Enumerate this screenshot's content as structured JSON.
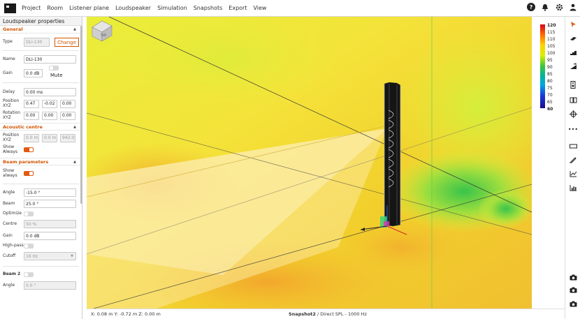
{
  "menu": [
    "Project",
    "Room",
    "Listener plane",
    "Loudspeaker",
    "Simulation",
    "Snapshots",
    "Export",
    "View"
  ],
  "panel": {
    "title": "Loudspeaker properties",
    "general": "General",
    "type_label": "Type",
    "type_value": "DLI-130",
    "change_button": "Change",
    "name_label": "Name",
    "name_value": "DLI-130",
    "gain_label": "Gain",
    "gain_value": "0.0 dB",
    "mute_label": "Mute",
    "delay_label": "Delay",
    "delay_value": "0.00 ms",
    "position_label": "Position XYZ",
    "position": [
      "0.47",
      "-0.02",
      "0.00"
    ],
    "rotation_label": "Rotation XYZ",
    "rotation": [
      "0.00",
      "0.00",
      "0.00"
    ],
    "acoustic_centre": "Acoustic centre",
    "ac_position_label": "Position XYZ",
    "ac_position": [
      "0.0 m",
      "0.0 m",
      "942.0"
    ],
    "show_always_label": "Show Always",
    "beam_parameters": "Beam parameters",
    "show_always2_label": "Show always",
    "angle_label": "Angle",
    "angle_value": "-15.0 °",
    "beam_label": "Beam",
    "beam_value": "25.0 °",
    "optimize_label": "Optimize",
    "centre_label": "Centre",
    "centre_value": "50 %",
    "gain2_label": "Gain",
    "gain2_value": "0.0 dB",
    "highpass_label": "High-pass",
    "cutoff_label": "Cutoff",
    "cutoff_value": "16 Hz",
    "beam2_label": "Beam 2",
    "angle2_label": "Angle",
    "angle2_value": "0.0 °"
  },
  "status": {
    "coords": "X: 0.08 m Y: -0.72 m Z: 0.00 m",
    "snapshot": "Snapshot2",
    "view": " / Direct SPL - 1000 Hz"
  },
  "scale": {
    "ticks": [
      "120",
      "115",
      "110",
      "105",
      "100",
      "95",
      "90",
      "85",
      "80",
      "75",
      "70",
      "65",
      "60"
    ],
    "colors": {
      "accent": "#e05a10"
    }
  },
  "cube_label": "SW"
}
